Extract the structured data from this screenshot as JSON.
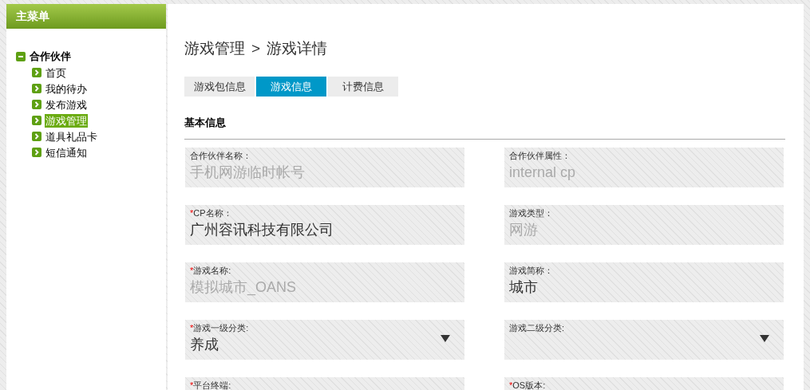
{
  "sidebar": {
    "title": "主菜单",
    "items": [
      {
        "label": "合作伙伴",
        "expanded": true,
        "children": [
          {
            "label": "首页",
            "selected": false
          },
          {
            "label": "我的待办",
            "selected": false
          },
          {
            "label": "发布游戏",
            "selected": false
          },
          {
            "label": "游戏管理",
            "selected": true
          },
          {
            "label": "道具礼品卡",
            "selected": false
          },
          {
            "label": "短信通知",
            "selected": false
          }
        ]
      }
    ]
  },
  "breadcrumb": [
    "游戏管理",
    ">",
    "游戏详情"
  ],
  "tabs": [
    {
      "label": "游戏包信息",
      "selected": false
    },
    {
      "label": "游戏信息",
      "selected": true
    },
    {
      "label": "计费信息",
      "selected": false
    }
  ],
  "section_title": "基本信息",
  "fields": [
    {
      "kind": "text",
      "label": "合作伙伴名称：",
      "disabled": true,
      "value": "手机网游临时帐号"
    },
    {
      "kind": "text",
      "label": "合作伙伴属性：",
      "disabled": true,
      "value": "internal cp"
    },
    {
      "kind": "text",
      "required_mark": "*",
      "label": "CP名称：",
      "disabled": false,
      "value": "广州容讯科技有限公司"
    },
    {
      "kind": "text",
      "label": "游戏类型：",
      "disabled": true,
      "value": "网游"
    },
    {
      "kind": "text",
      "required_mark": "*",
      "label": "游戏名称:",
      "disabled": true,
      "value": "模拟城市_OANS"
    },
    {
      "kind": "text",
      "label": "游戏简称：",
      "disabled": false,
      "value": "城市"
    },
    {
      "kind": "select",
      "required_mark": "*",
      "label": "游戏一级分类:",
      "disabled": false,
      "value": "养成"
    },
    {
      "kind": "select",
      "label": "游戏二级分类:"
    },
    {
      "kind": "text",
      "required_mark": "*",
      "label": "平台终端:"
    },
    {
      "kind": "text",
      "required_mark": "*",
      "label": "OS版本:"
    }
  ]
}
